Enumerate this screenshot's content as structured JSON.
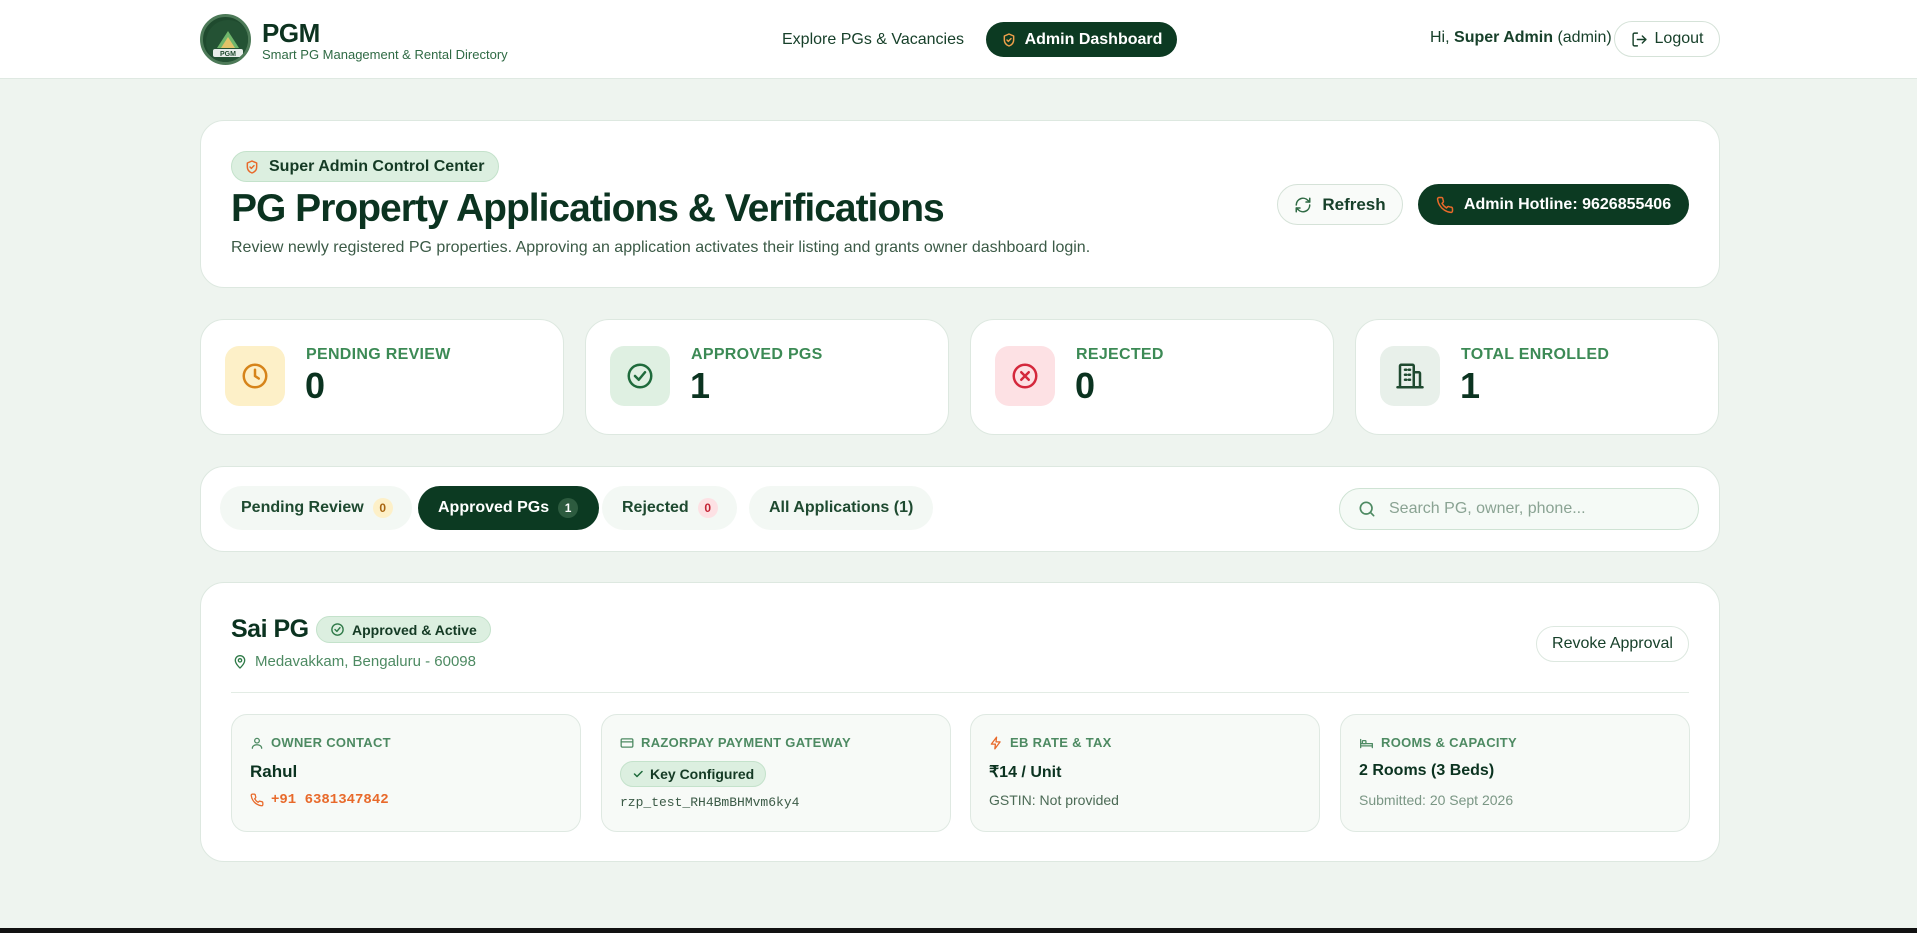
{
  "brand": {
    "name": "PGM",
    "tagline": "Smart PG Management & Rental Directory",
    "logo_text": "PGM"
  },
  "nav": {
    "explore": "Explore PGs & Vacancies",
    "admin": "Admin Dashboard"
  },
  "user": {
    "greeting": "Hi,",
    "name": "Super Admin",
    "role": "(admin)",
    "logout": "Logout"
  },
  "hero": {
    "badge": "Super Admin Control Center",
    "title": "PG Property Applications & Verifications",
    "subtitle": "Review newly registered PG properties. Approving an application activates their listing and grants owner dashboard login.",
    "refresh": "Refresh",
    "hotline": "Admin Hotline: 9626855406"
  },
  "stats": [
    {
      "label": "PENDING REVIEW",
      "value": "0",
      "icon": "clock-icon"
    },
    {
      "label": "APPROVED PGS",
      "value": "1",
      "icon": "check-circle-icon"
    },
    {
      "label": "REJECTED",
      "value": "0",
      "icon": "x-circle-icon"
    },
    {
      "label": "TOTAL ENROLLED",
      "value": "1",
      "icon": "building-icon"
    }
  ],
  "tabs": [
    {
      "label": "Pending Review",
      "count": "0"
    },
    {
      "label": "Approved PGs",
      "count": "1",
      "active": true
    },
    {
      "label": "Rejected",
      "count": "0"
    },
    {
      "label": "All Applications (1)"
    }
  ],
  "search": {
    "placeholder": "Search PG, owner, phone..."
  },
  "listing": {
    "name": "Sai PG",
    "status": "Approved & Active",
    "location": "Medavakkam, Bengaluru - 60098",
    "revoke": "Revoke Approval",
    "owner": {
      "label": "OWNER CONTACT",
      "name": "Rahul",
      "phone": "+91 6381347842"
    },
    "gateway": {
      "label": "RAZORPAY PAYMENT GATEWAY",
      "status": "Key Configured",
      "key": "rzp_test_RH4BmBHMvm6ky4"
    },
    "eb": {
      "label": "EB RATE & TAX",
      "rate": "₹14 / Unit",
      "gstin": "GSTIN: Not provided"
    },
    "rooms": {
      "label": "ROOMS & CAPACITY",
      "capacity": "2 Rooms (3 Beds)",
      "submitted": "Submitted: 20 Sept 2026"
    }
  },
  "colors": {
    "primary": "#0c3a22",
    "accent_green": "#3c8a55",
    "orange": "#e8692a",
    "background": "#eef4ef"
  }
}
